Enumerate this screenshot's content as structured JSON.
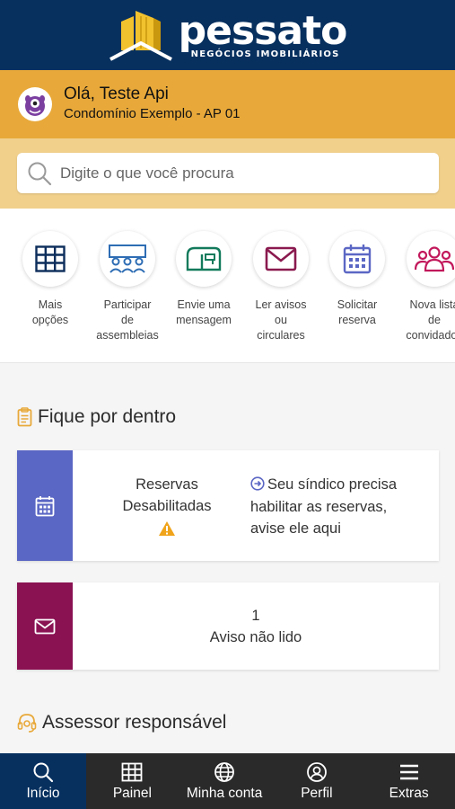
{
  "brand": {
    "name": "pessato",
    "tagline": "NEGÓCIOS IMOBILIÁRIOS",
    "header_color": "#07305f",
    "logo_color": "#f2c12e"
  },
  "user": {
    "greeting": "Olá, Teste Api",
    "unit": "Condomínio Exemplo - AP 01",
    "avatar_icon": "purple-monster-avatar"
  },
  "search": {
    "placeholder": "Digite o que você procura",
    "value": ""
  },
  "actions": [
    {
      "line1": "Mais",
      "line2": "opções",
      "line3": "",
      "icon": "grid-icon",
      "color": "#0d2e5c"
    },
    {
      "line1": "Participar",
      "line2": "de",
      "line3": "assembleias",
      "icon": "group-icon",
      "color": "#2e6db4"
    },
    {
      "line1": "Envie uma",
      "line2": "mensagem",
      "line3": "",
      "icon": "mailbox-icon",
      "color": "#127a5b"
    },
    {
      "line1": "Ler avisos",
      "line2": "ou",
      "line3": "circulares",
      "icon": "envelope-icon",
      "color": "#8a1a4f"
    },
    {
      "line1": "Solicitar",
      "line2": "reserva",
      "line3": "",
      "icon": "calendar-icon",
      "color": "#5b67c4"
    },
    {
      "line1": "Nova lista",
      "line2": "de",
      "line3": "convidados",
      "icon": "guests-icon",
      "color": "#c2185b"
    }
  ],
  "feed": {
    "title": "Fique por dentro",
    "reservas": {
      "title_line1": "Reservas",
      "title_line2": "Desabilitadas",
      "note_line1": "Seu síndico precisa",
      "note_line2": "habilitar as reservas,",
      "note_line3": "avise ele aqui",
      "side_color": "#5b67c4"
    },
    "avisos": {
      "count": "1",
      "label": "Aviso não lido",
      "side_color": "#8a1253"
    }
  },
  "assessor": {
    "title": "Assessor responsável"
  },
  "nav": [
    {
      "label": "Início",
      "icon": "search-icon",
      "active": true
    },
    {
      "label": "Painel",
      "icon": "grid-icon",
      "active": false
    },
    {
      "label": "Minha conta",
      "icon": "globe-icon",
      "active": false
    },
    {
      "label": "Perfil",
      "icon": "user-icon",
      "active": false
    },
    {
      "label": "Extras",
      "icon": "menu-icon",
      "active": false
    }
  ]
}
